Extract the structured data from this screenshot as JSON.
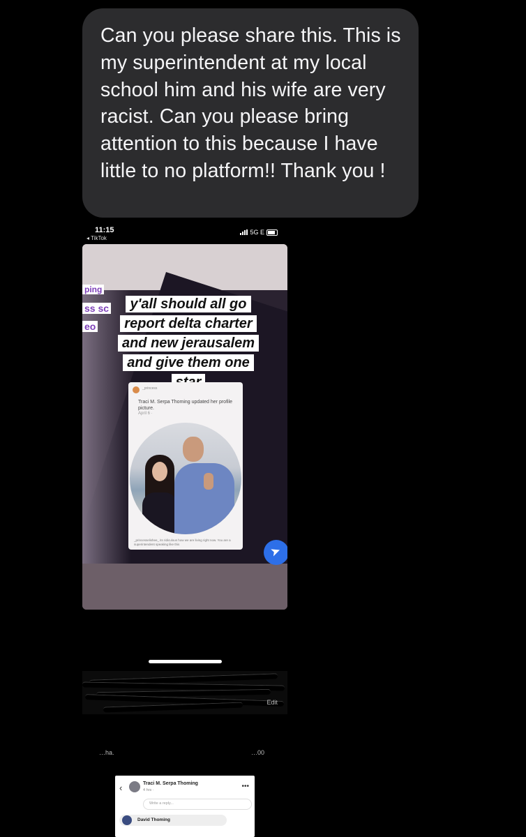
{
  "message": {
    "text": "Can you please share this. This is my superintendent at my local school him and his wife are very racist. Can you please bring attention to this because I have little to no platform!! Thank you !"
  },
  "attachment": {
    "status_time": "11:15",
    "status_back": "◂ TikTok",
    "network": "5G E",
    "caption_lines": [
      "y'all should all go",
      "report delta charter",
      "and new jerausalem",
      "and give them one",
      "star"
    ],
    "partial_text_1": "ping",
    "partial_text_2": "ss sc",
    "partial_text_3": "eo",
    "fb_card": {
      "user": "_princess",
      "name_line": "Traci M. Serpa Thoming updated her profile picture.",
      "date": "April 6 ·  ",
      "comment": "_princesselishee_ its ridiculous how we are living right now. You are a superintendent speaking like this"
    }
  },
  "redacted": {
    "edit_label": "Edit",
    "ghost_left": "…ha.",
    "ghost_right": "…00"
  },
  "fb_snippet": {
    "name": "Traci M. Serpa Thoming",
    "time": "4 hrs · ",
    "reply_placeholder": "Write a reply...",
    "commenter": "David Thoming"
  },
  "colors": {
    "bubble": "#2c2c2e",
    "send_button": "#2d6fe8",
    "caption_purple": "#7d3fb8"
  }
}
